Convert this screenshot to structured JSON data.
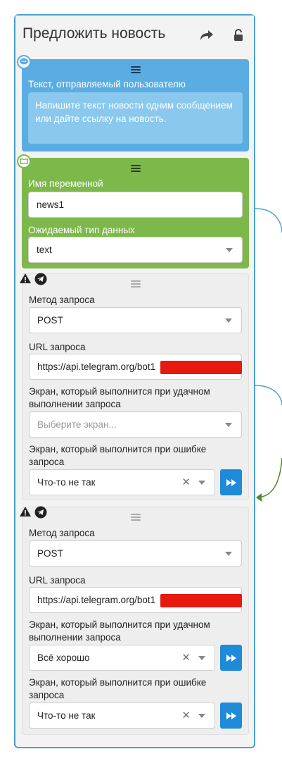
{
  "header": {
    "title": "Предложить новость",
    "share_icon": "share-arrow-icon",
    "lock_icon": "unlock-icon"
  },
  "message_block": {
    "label": "Текст, отправляемый пользователю",
    "text": "Напишите текст новости одним сообщением или дайте ссылку на новость.",
    "bg": "#5aade2"
  },
  "input_block": {
    "var_label": "Имя переменной",
    "var_value": "news1",
    "type_label": "Ожидаемый тип данных",
    "type_value": "text",
    "bg": "#7cb84a"
  },
  "request1": {
    "method_label": "Метод запроса",
    "method_value": "POST",
    "url_label": "URL запроса",
    "url_value": "https://api.telegram.org/bot1",
    "success_label": "Экран, который выполнится при удачном выполнении запроса",
    "success_placeholder": "Выберите экран...",
    "error_label": "Экран, который выполнится при ошибке запроса",
    "error_value": "Что-то не так"
  },
  "request2": {
    "method_label": "Метод запроса",
    "method_value": "POST",
    "url_label": "URL запроса",
    "url_value": "https://api.telegram.org/bot1",
    "success_label": "Экран, который выполнится при удачном выполнении запроса",
    "success_value": "Всё хорошо",
    "error_label": "Экран, который выполнится при ошибке запроса",
    "error_value": "Что-то не так"
  },
  "colors": {
    "accent": "#1f8ad8",
    "border": "#4a9fd5",
    "connector_blue": "#4ba3d9",
    "connector_green": "#4f8a2e"
  }
}
